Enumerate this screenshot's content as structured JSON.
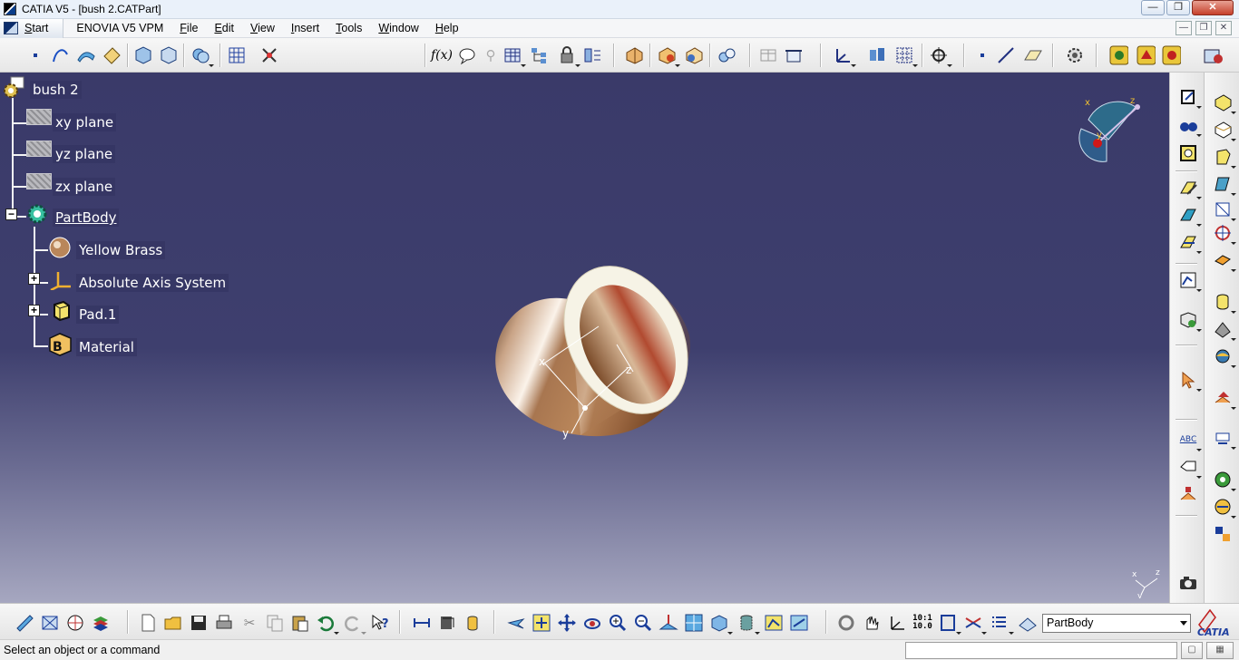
{
  "window": {
    "title": "CATIA V5 - [bush 2.CATPart]",
    "minimize": "—",
    "maximize": "❐",
    "close": "✕"
  },
  "menubar": {
    "start": "Start",
    "enovia": "ENOVIA V5 VPM",
    "items": [
      "File",
      "Edit",
      "View",
      "Insert",
      "Tools",
      "Window",
      "Help"
    ],
    "mdi": [
      "—",
      "❐",
      "✕"
    ]
  },
  "tree": {
    "root": "bush 2",
    "planes": [
      "xy plane",
      "yz plane",
      "zx plane"
    ],
    "partbody": "PartBody",
    "children": [
      "Yellow Brass",
      "Absolute Axis System",
      "Pad.1",
      "Material"
    ]
  },
  "model": {
    "axis_labels": {
      "x": "x",
      "y": "y",
      "z": "z"
    },
    "compass_labels": {
      "x": "x",
      "y": "y",
      "z": "z"
    },
    "colors": {
      "brass_dark": "#7a4a28",
      "brass_mid": "#b9865a",
      "brass_light": "#f0dcc4",
      "rim": "#f6f3e6",
      "background_top": "#3a3a69",
      "background_bottom": "#a6a7c0"
    }
  },
  "bottom_toolbar": {
    "current_body": "PartBody",
    "brand": "CATIA"
  },
  "status": {
    "message": "Select an object or a command",
    "command_value": ""
  },
  "icons": {
    "top": [
      "point-icon",
      "spline-icon",
      "surface-icon",
      "sketch-icon",
      "part-design-icon",
      "constraint-icon",
      "boolean-icon",
      "grid-icon",
      "snap-icon",
      "formula-icon",
      "comment-icon",
      "light-icon",
      "table-icon",
      "tree-icon",
      "lock-icon",
      "param-icon",
      "measure-icon",
      "render-icon",
      "material-icon",
      "apply-material-icon",
      "swap-icon",
      "align-icon",
      "axis-system-icon",
      "catalog-icon",
      "grid-3d-icon",
      "compass-icon",
      "point-small-icon",
      "line-icon",
      "plane-icon",
      "gear-icon",
      "workbench-icon",
      "workbench-2-icon",
      "workbench-3-icon",
      "catalog-browser-icon"
    ]
  }
}
